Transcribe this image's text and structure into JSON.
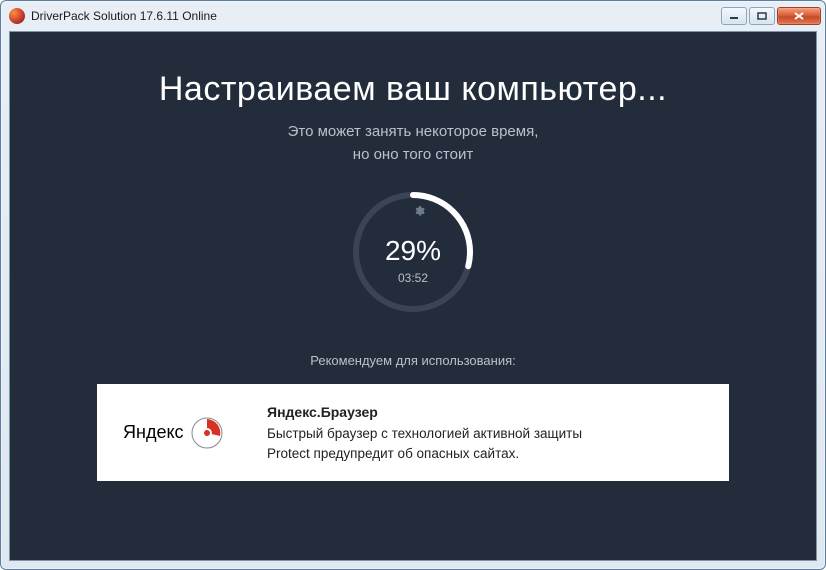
{
  "window": {
    "title": "DriverPack Solution 17.6.11 Online"
  },
  "main": {
    "heading": "Настраиваем ваш компьютер...",
    "subtitle_line1": "Это может занять некоторое время,",
    "subtitle_line2": "но оно того стоит",
    "progress": {
      "percent_value": 29,
      "percent_label": "29%",
      "elapsed": "03:52"
    },
    "recommend_label": "Рекомендуем для использования:"
  },
  "recommendation": {
    "brand": "Яндекс",
    "title": "Яндекс.Браузер",
    "line1": "Быстрый браузер с технологией активной защиты",
    "line2": "Protect предупредит об опасных сайтах."
  }
}
